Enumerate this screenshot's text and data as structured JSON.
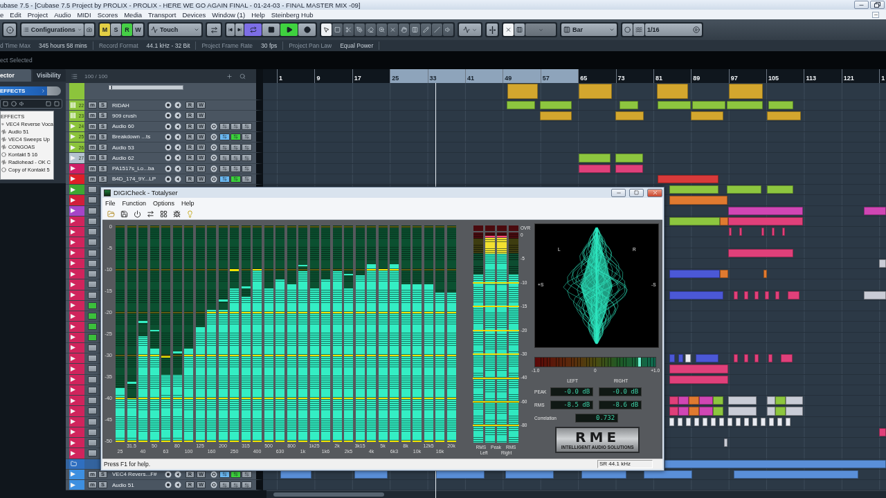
{
  "window": {
    "title": "ubase 7.5 - [Cubase 7.5 Project by PROLIX - PROLIX - HERE WE GO AGAIN FINAL - 01-24-03 - FINAL MASTER MIX -09]"
  },
  "menu": [
    "e",
    "Edit",
    "Project",
    "Audio",
    "MIDI",
    "Scores",
    "Media",
    "Transport",
    "Devices",
    "Window (1)",
    "Help",
    "Steinberg Hub"
  ],
  "toolbar": {
    "configurations": "Configurations",
    "modes": [
      {
        "label": "M",
        "on": true,
        "color": "#e3cf45"
      },
      {
        "label": "S",
        "on": false
      },
      {
        "label": "R",
        "on": true,
        "color": "#46cf46"
      },
      {
        "label": "W",
        "on": false
      }
    ],
    "automation": "Touch",
    "transport": [
      {
        "kind": "to-start",
        "on": false
      },
      {
        "kind": "to-end",
        "on": false
      },
      {
        "kind": "cycle",
        "on": true
      },
      {
        "kind": "stop",
        "on": false
      },
      {
        "kind": "play",
        "on": true
      },
      {
        "kind": "record",
        "on": false
      }
    ],
    "tools": [
      {
        "kind": "pointer",
        "selected": true
      },
      {
        "kind": "range",
        "selected": false
      },
      {
        "kind": "split",
        "selected": false
      },
      {
        "kind": "glue",
        "selected": false
      },
      {
        "kind": "eraser",
        "selected": false
      },
      {
        "kind": "zoom",
        "selected": false
      },
      {
        "kind": "mute",
        "selected": false
      },
      {
        "kind": "hand",
        "selected": false
      },
      {
        "kind": "comb",
        "selected": false
      },
      {
        "kind": "pencil",
        "selected": false
      },
      {
        "kind": "line",
        "selected": false
      },
      {
        "kind": "speaker",
        "selected": false
      }
    ],
    "snap_on": true,
    "grid": "Bar",
    "quantize": "1/16"
  },
  "info": [
    {
      "label": "d Time Max",
      "value": "345 hours 58 mins"
    },
    {
      "label": "Record Format",
      "value": "44.1 kHz - 32 Bit"
    },
    {
      "label": "Project Frame Rate",
      "value": "30 fps"
    },
    {
      "label": "Project Pan Law",
      "value": "Equal Power"
    }
  ],
  "selection": "ect Selected",
  "inspector": {
    "tabs": [
      {
        "label": "ector",
        "selected": true
      },
      {
        "label": "Visibility",
        "selected": false
      }
    ],
    "section": "EFFECTS",
    "list_title": "EFFECTS",
    "items": [
      {
        "name": "VEC4 Reverse Voca",
        "kind": "audio"
      },
      {
        "name": "Audio 51",
        "kind": "audio"
      },
      {
        "name": "VEC4 Sweeps Up",
        "kind": "audio"
      },
      {
        "name": "CONGOAS",
        "kind": "audio"
      },
      {
        "name": "Kontakt 5 16",
        "kind": "instrument"
      },
      {
        "name": "Radiohead - OK C",
        "kind": "audio"
      },
      {
        "name": "Copy of Kontakt 5",
        "kind": "instrument"
      }
    ]
  },
  "track_list": {
    "count": "100 / 100",
    "tracks": [
      {
        "kind": "tall",
        "color": "#8cc43c",
        "level": 0.04
      },
      {
        "kind": "instrument",
        "number": "22",
        "name": "RIDAH",
        "color": "#8cc43c",
        "buttons": [
          "m",
          "S",
          "R",
          "W"
        ]
      },
      {
        "kind": "instrument",
        "number": "23",
        "name": "909 crush",
        "color": "#8cc43c",
        "buttons": [
          "m",
          "S",
          "R",
          "W"
        ]
      },
      {
        "kind": "audio",
        "number": "24",
        "name": "Audio 60",
        "color": "#8cc43c",
        "buttons": [
          "m",
          "S",
          "R",
          "W"
        ],
        "buttons_lit": false
      },
      {
        "kind": "audio",
        "number": "25",
        "name": "Breakdown ...ts",
        "color": "#8cc43c",
        "buttons": [
          "m",
          "S",
          "R",
          "W"
        ],
        "buttons_lit": true
      },
      {
        "kind": "audio",
        "number": "26",
        "name": "Audio 53",
        "color": "#8cc43c",
        "buttons": [
          "m",
          "S",
          "R",
          "W"
        ],
        "buttons_lit": false
      },
      {
        "kind": "audio",
        "number": "27",
        "name": "Audio 62",
        "color": "#b4c3cf",
        "buttons": [
          "m",
          "S",
          "R",
          "W"
        ],
        "buttons_lit": false
      },
      {
        "kind": "audio",
        "name": "PA1517s_Lo...ba",
        "color": "#cf1f66",
        "buttons": [
          "m",
          "S",
          "R",
          "W"
        ],
        "buttons_lit": false
      },
      {
        "kind": "audio",
        "name": "B4D_174_9Y...LP",
        "color": "#de1f28",
        "buttons": [
          "m",
          "S",
          "R",
          "W"
        ],
        "buttons_lit": true
      },
      {
        "kind": "audio",
        "color": "#3ea832"
      },
      {
        "kind": "audio",
        "color": "#d11f3a"
      },
      {
        "kind": "audio",
        "color": "#a545c8"
      },
      {
        "kind": "audio",
        "color": "#d0245c"
      },
      {
        "kind": "audio",
        "color": "#d0245c"
      },
      {
        "kind": "audio",
        "color": "#d0245c"
      },
      {
        "kind": "audio",
        "color": "#d0245c"
      },
      {
        "kind": "audio",
        "color": "#d0245c"
      },
      {
        "kind": "audio",
        "color": "#d0245c"
      },
      {
        "kind": "audio",
        "color": "#d0245c"
      },
      {
        "kind": "audio",
        "color": "#d0245c"
      },
      {
        "kind": "midi",
        "color": "#d0245c"
      },
      {
        "kind": "midi",
        "color": "#d0245c"
      },
      {
        "kind": "midi",
        "color": "#d0245c"
      },
      {
        "kind": "midi",
        "color": "#d0245c"
      },
      {
        "kind": "audio",
        "color": "#d0245c"
      },
      {
        "kind": "audio",
        "color": "#d0245c"
      },
      {
        "kind": "audio",
        "color": "#d0245c"
      },
      {
        "kind": "audio",
        "color": "#d0245c"
      },
      {
        "kind": "audio",
        "color": "#d0245c"
      },
      {
        "kind": "audio",
        "color": "#d0245c"
      },
      {
        "kind": "audio",
        "color": "#d0245c"
      },
      {
        "kind": "audio",
        "color": "#d0245c"
      },
      {
        "kind": "audio",
        "color": "#d0245c"
      },
      {
        "kind": "audio",
        "color": "#d0245c"
      },
      {
        "kind": "audio",
        "color": "#d0245c"
      },
      {
        "kind": "folder",
        "color": "#2f6fc0"
      },
      {
        "kind": "audio",
        "name": "VEC4 Revers...F#",
        "color": "#3d8fe0",
        "buttons": [
          "m",
          "S",
          "R",
          "W"
        ],
        "buttons_lit": true
      },
      {
        "kind": "audio",
        "name": "Audio 51",
        "color": "#3d8fe0",
        "buttons": [
          "m",
          "S",
          "R",
          "W"
        ],
        "buttons_lit": false
      }
    ]
  },
  "ruler": [
    {
      "label": "1",
      "in_cycle": false
    },
    {
      "label": "9",
      "in_cycle": false
    },
    {
      "label": "17",
      "in_cycle": false
    },
    {
      "label": "25",
      "in_cycle": true
    },
    {
      "label": "33",
      "in_cycle": true
    },
    {
      "label": "41",
      "in_cycle": true
    },
    {
      "label": "49",
      "in_cycle": true
    },
    {
      "label": "57",
      "in_cycle": true
    },
    {
      "label": "65",
      "in_cycle": false
    },
    {
      "label": "73",
      "in_cycle": false
    },
    {
      "label": "81",
      "in_cycle": false
    },
    {
      "label": "89",
      "in_cycle": false
    },
    {
      "label": "97",
      "in_cycle": false
    },
    {
      "label": "105",
      "in_cycle": false
    },
    {
      "label": "113",
      "in_cycle": false
    },
    {
      "label": "121",
      "in_cycle": false
    },
    {
      "label": "1",
      "in_cycle": false
    }
  ],
  "digicheck": {
    "title": "DIGICheck - Totalyser",
    "menu": [
      "File",
      "Function",
      "Options",
      "Help"
    ],
    "tools": [
      {
        "kind": "open"
      },
      {
        "kind": "save"
      },
      {
        "kind": "power"
      },
      {
        "kind": "function"
      },
      {
        "kind": "layout"
      },
      {
        "kind": "bug"
      },
      {
        "kind": "help"
      }
    ],
    "spectrum": {
      "scale": [
        "0",
        "-5",
        "-10",
        "-15",
        "-20",
        "-25",
        "-30",
        "-35",
        "-40",
        "-45",
        "-50"
      ],
      "bands": [
        {
          "label": "25",
          "level": 0.25
        },
        {
          "label": "31.5",
          "level": 0.2,
          "peak_hold": {
            "level": 0.28
          }
        },
        {
          "label": "40",
          "level": 0.49,
          "peak_hold": {
            "level": 0.56
          }
        },
        {
          "label": "50",
          "level": 0.43,
          "peak_hold": {
            "level": 0.52
          }
        },
        {
          "label": "63",
          "level": 0.31,
          "peak_hold": {
            "level": 0.4
          }
        },
        {
          "label": "80",
          "level": 0.31,
          "peak_hold": {
            "level": 0.42
          }
        },
        {
          "label": "100",
          "level": 0.43
        },
        {
          "label": "125",
          "level": 0.53
        },
        {
          "label": "160",
          "level": 0.61
        },
        {
          "label": "200",
          "level": 0.61,
          "peak_hold": {
            "level": 0.66
          }
        },
        {
          "label": "250",
          "level": 0.71,
          "peak_hold": {
            "level": 0.8
          }
        },
        {
          "label": "315",
          "level": 0.67,
          "peak_hold": {
            "level": 0.72
          }
        },
        {
          "label": "400",
          "level": 0.8
        },
        {
          "label": "500",
          "level": 0.71
        },
        {
          "label": "630",
          "level": 0.75
        },
        {
          "label": "800",
          "level": 0.73
        },
        {
          "label": "1k",
          "level": 0.79,
          "peak_hold": {
            "level": 0.82
          }
        },
        {
          "label": "1k25",
          "level": 0.71
        },
        {
          "label": "1k6",
          "level": 0.75
        },
        {
          "label": "2k",
          "level": 0.79
        },
        {
          "label": "2k5",
          "level": 0.71,
          "peak_hold": {
            "level": 0.78
          }
        },
        {
          "label": "3k15",
          "level": 0.77
        },
        {
          "label": "4k",
          "level": 0.82
        },
        {
          "label": "5k",
          "level": 0.8
        },
        {
          "label": "6k3",
          "level": 0.82
        },
        {
          "label": "8k",
          "level": 0.73
        },
        {
          "label": "10k",
          "level": 0.73
        },
        {
          "label": "12k5",
          "level": 0.73
        },
        {
          "label": "16k",
          "level": 0.69
        },
        {
          "label": "20k",
          "level": 0.69
        }
      ]
    },
    "meters": [
      {
        "level": 0.8
      },
      {
        "level": 0.985
      },
      {
        "level": 0.985
      },
      {
        "level": 0.8
      }
    ],
    "meter_scale": [
      "OVR",
      "0",
      "-5",
      "-10",
      "-15",
      "-20",
      "-30",
      "-40",
      "-60",
      "-80"
    ],
    "meter_labels": [
      [
        "RMS",
        "Peak",
        "RMS"
      ],
      [
        "Left",
        "Right"
      ]
    ],
    "goniometer": {
      "labels": [
        "L",
        "R",
        "+S",
        "-S"
      ]
    },
    "correlation": {
      "level": 0.87,
      "scale": [
        "-1.0",
        "0",
        "+1.0"
      ]
    },
    "readouts": {
      "headers": [
        "LEFT",
        "RIGHT"
      ],
      "rows": [
        {
          "label": "PEAK",
          "values": [
            "-0.0 dB",
            "-0.0 dB"
          ]
        },
        {
          "label": "RMS",
          "values": [
            "-8.5 dB",
            "-8.6 dB"
          ]
        }
      ],
      "correlation": {
        "label": "Correlation",
        "value": "0.732"
      }
    },
    "logo": {
      "wordmark": "RME",
      "tagline": "INTELLIGENT AUDIO SOLUTIONS"
    },
    "status": {
      "text": "Press F1 for help.",
      "sample_rate": "SR 44.1 kHz"
    }
  }
}
